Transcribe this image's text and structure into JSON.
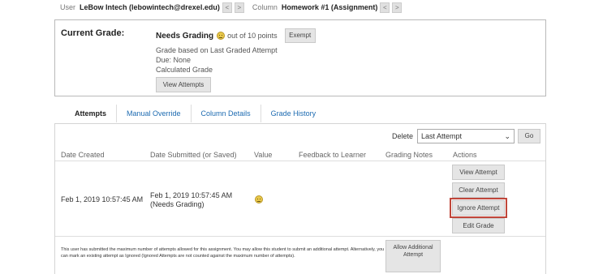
{
  "header": {
    "user_label": "User",
    "user_value": "LeBow Intech (lebowintech@drexel.edu)",
    "prev_icon": "chevron-left-icon",
    "next_icon": "chevron-right-icon",
    "prev_glyph": "<",
    "next_glyph": ">",
    "column_label": "Column",
    "column_value": "Homework #1 (Assignment)"
  },
  "current_grade": {
    "title": "Current Grade:",
    "status": "Needs Grading",
    "status_icon": "needs-grading-icon",
    "points_text": "out of 10 points",
    "exempt_label": "Exempt",
    "lines": [
      "Grade based on Last Graded Attempt",
      "Due: None",
      "Calculated Grade"
    ],
    "view_attempts_label": "View Attempts"
  },
  "tabs": [
    {
      "label": "Attempts",
      "active": true
    },
    {
      "label": "Manual Override",
      "active": false
    },
    {
      "label": "Column Details",
      "active": false
    },
    {
      "label": "Grade History",
      "active": false
    }
  ],
  "delete_bar": {
    "label": "Delete",
    "selected": "Last Attempt",
    "chevron_glyph": "⌄",
    "go_label": "Go"
  },
  "table": {
    "headers": [
      "Date Created",
      "Date Submitted (or Saved)",
      "Value",
      "Feedback to Learner",
      "Grading Notes",
      "Actions"
    ],
    "row": {
      "date_created": "Feb 1, 2019 10:57:45 AM",
      "date_submitted": "Feb 1, 2019 10:57:45 AM",
      "submitted_status": "(Needs Grading)",
      "value_icon": "needs-grading-icon"
    },
    "actions": [
      "View Attempt",
      "Clear Attempt",
      "Ignore Attempt",
      "Edit Grade"
    ]
  },
  "footer": {
    "message": "This user has submitted the maximum number of attempts allowed for this assignment. You may allow this student to submit an additional attempt. Alternatively, you can mark an existing attempt as Ignored (Ignored Attempts are not counted against the maximum number of attempts).",
    "allow_label": "Allow Additional Attempt"
  },
  "colors": {
    "link": "#1d6bb1",
    "highlight": "#c0463a",
    "button_bg": "#e5e5e5"
  }
}
